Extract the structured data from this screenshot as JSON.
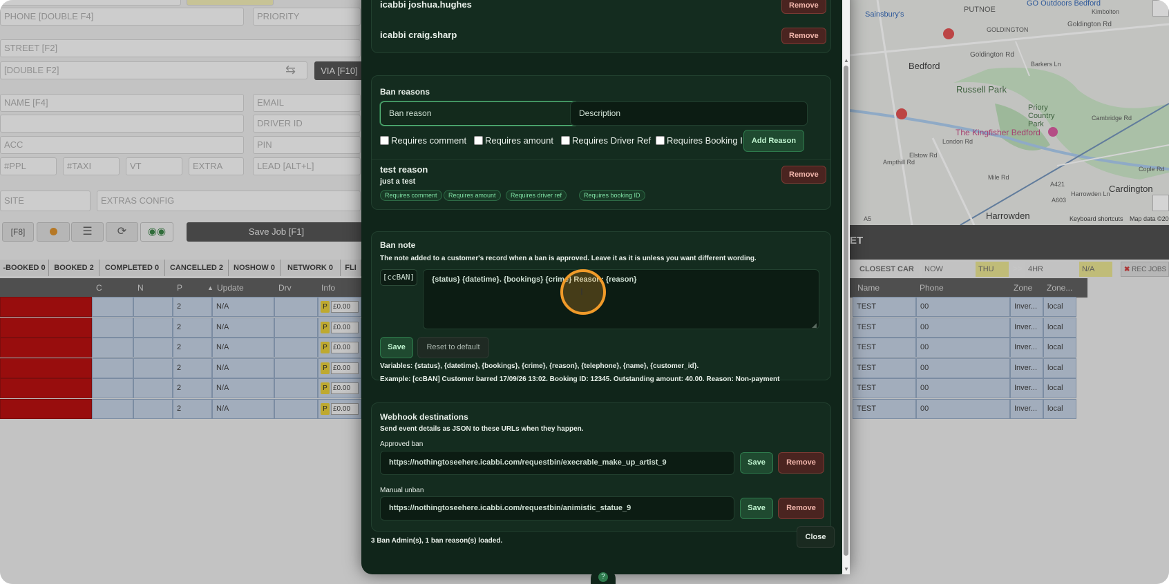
{
  "bg": {
    "fields": {
      "phone": "PHONE [DOUBLE F4]",
      "priority": "PRIORITY",
      "street": "STREET [F2]",
      "double_f2": "[DOUBLE F2]",
      "via_btn": "VIA [F10]",
      "name": "NAME [F4]",
      "email": "EMAIL",
      "driver_id": "DRIVER ID",
      "acc": "ACC",
      "pin": "PIN",
      "ppl": "#PPL",
      "taxi": "#TAXI",
      "vt": "VT",
      "extra": "EXTRA",
      "lead": "LEAD [ALT+L]",
      "site": "SITE",
      "extras_config": "EXTRAS CONFIG"
    },
    "toolbar": {
      "f8": "[F8]",
      "save_job": "Save Job [F1]"
    },
    "tabs": [
      "-BOOKED 0",
      "BOOKED 2",
      "COMPLETED 0",
      "CANCELLED 2",
      "NOSHOW 0",
      "NETWORK 0",
      "FLI"
    ],
    "columns": [
      "C",
      "N",
      "P",
      "Update",
      "Drv",
      "Info"
    ],
    "rows": [
      {
        "p": "2",
        "update": "N/A",
        "amount": "£0.00"
      },
      {
        "p": "2",
        "update": "N/A",
        "amount": "£0.00"
      },
      {
        "p": "2",
        "update": "N/A",
        "amount": "£0.00"
      },
      {
        "p": "2",
        "update": "N/A",
        "amount": "£0.00"
      },
      {
        "p": "2",
        "update": "N/A",
        "amount": "£0.00"
      },
      {
        "p": "2",
        "update": "N/A",
        "amount": "£0.00"
      }
    ],
    "p_badge": "P",
    "right_panel": {
      "closest_car": "CLOSEST CAR",
      "now": "NOW",
      "thu": "THU",
      "arrows": ">>",
      "hr": "4HR",
      "na": "N/A",
      "rec_jobs": "REC JOBS",
      "et": "ET",
      "columns": [
        "Name",
        "Phone",
        "Zone",
        "Zone..."
      ],
      "rows": [
        {
          "name": "TEST",
          "phone": "00",
          "zone": "Inver...",
          "zone2": "local"
        },
        {
          "name": "TEST",
          "phone": "00",
          "zone": "Inver...",
          "zone2": "local"
        },
        {
          "name": "TEST",
          "phone": "00",
          "zone": "Inver...",
          "zone2": "local"
        },
        {
          "name": "TEST",
          "phone": "00",
          "zone": "Inver...",
          "zone2": "local"
        },
        {
          "name": "TEST",
          "phone": "00",
          "zone": "Inver...",
          "zone2": "local"
        },
        {
          "name": "TEST",
          "phone": "00",
          "zone": "Inver...",
          "zone2": "local"
        }
      ]
    },
    "map": {
      "labels": [
        "Sainsbury's",
        "PUTNOE",
        "GO Outdoors Bedford",
        "GOLDINGTON",
        "Goldington Rd",
        "Goldington Rd",
        "Bedford",
        "Russell Park",
        "Priory Country Park",
        "The Kingfisher Bedford",
        "Cambridge Rd",
        "Mile Rd",
        "Cardington",
        "Harrowden",
        "Harrowden Ln",
        "Cople Rd",
        "Ampthill Rd",
        "Elstow Rd",
        "London Rd",
        "Barkers Ln",
        "Kimbolton",
        "A603",
        "A421",
        "A5",
        "Keyboard shortcuts",
        "Map data ©20"
      ]
    }
  },
  "modal": {
    "admins": [
      {
        "name": "icabbi joshua.hughes",
        "remove": "Remove"
      },
      {
        "name": "icabbi craig.sharp",
        "remove": "Remove"
      }
    ],
    "ban_reasons": {
      "title": "Ban reasons",
      "reason_value": "Ban reason",
      "description_placeholder": "Description",
      "checks": [
        "Requires comment",
        "Requires amount",
        "Requires Driver Ref",
        "Requires Booking ID"
      ],
      "add_button": "Add Reason",
      "existing": {
        "name": "test reason",
        "desc": "just a test",
        "tags": [
          "Requires comment",
          "Requires amount",
          "Requires driver ref",
          "Requires booking ID"
        ],
        "remove": "Remove"
      }
    },
    "ban_note": {
      "title": "Ban note",
      "subtitle": "The note added to a customer's record when a ban is approved. Leave it as it is unless you want different wording.",
      "prefix": "[ccBAN]",
      "template": "{status} {datetime}. {bookings} {crime} Reason: {reason}",
      "save": "Save",
      "reset": "Reset to default",
      "variables": "Variables: {status}, {datetime}, {bookings}, {crime}, {reason}, {telephone}, {name}, {customer_id}.",
      "example": "Example: [ccBAN] Customer barred 17/09/26 13:02. Booking ID: 12345. Outstanding amount: 40.00. Reason: Non-payment"
    },
    "webhooks": {
      "title": "Webhook destinations",
      "subtitle": "Send event details as JSON to these URLs when they happen.",
      "items": [
        {
          "label": "Approved ban",
          "url": "https://nothingtoseehere.icabbi.com/requestbin/execrable_make_up_artist_9",
          "save": "Save",
          "remove": "Remove"
        },
        {
          "label": "Manual unban",
          "url": "https://nothingtoseehere.icabbi.com/requestbin/animistic_statue_9",
          "save": "Save",
          "remove": "Remove"
        }
      ]
    },
    "status": "3 Ban Admin(s), 1 ban reason(s) loaded.",
    "close": "Close",
    "bottom_badge": "?"
  },
  "colors": {
    "modal_bg": "#10251a",
    "accent_green": "#2e7a4c",
    "remove_red": "#7a3a33",
    "cursor_highlight": "#f09a29",
    "row_red": "#b30000"
  }
}
